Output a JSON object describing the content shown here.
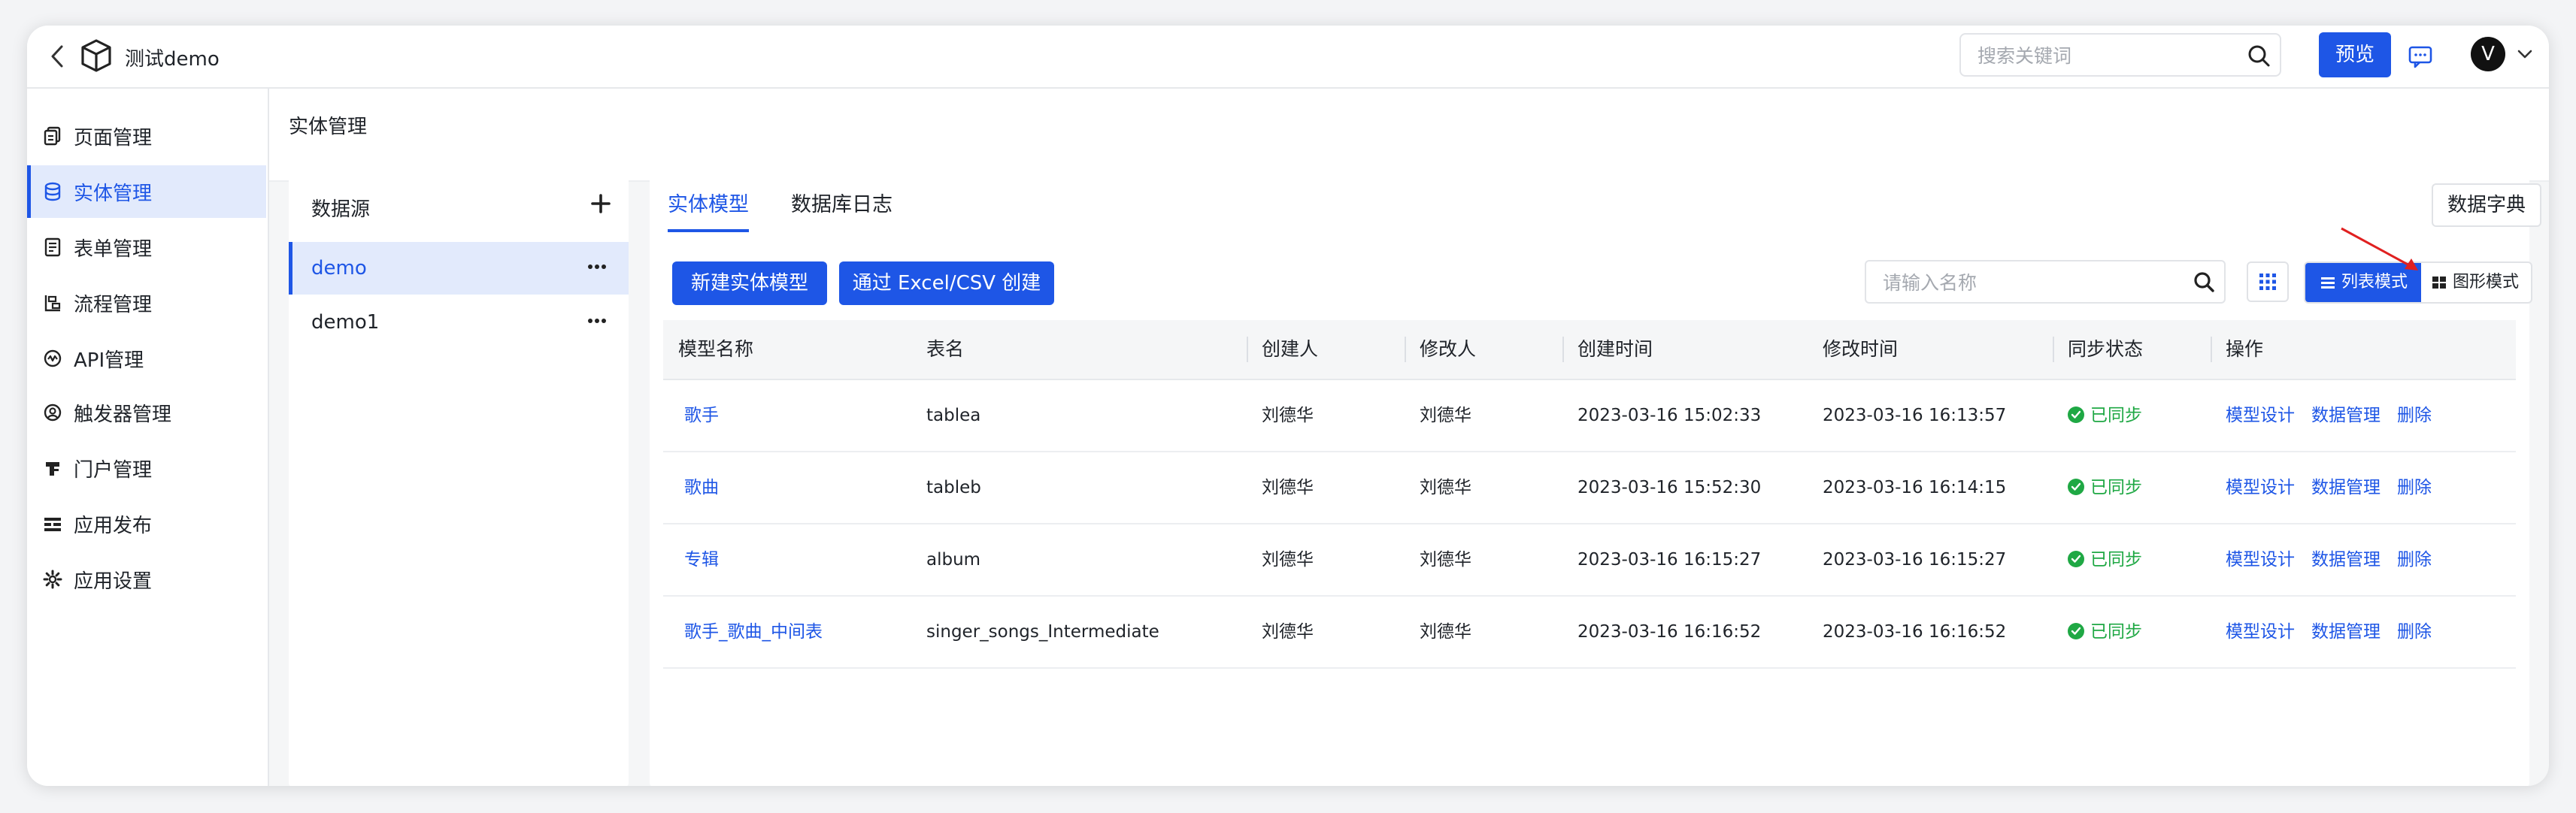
{
  "header": {
    "app_title": "测试demo",
    "search_placeholder": "搜索关键词",
    "preview_label": "预览",
    "avatar_letter": "V"
  },
  "sidebar": {
    "items": [
      {
        "label": "页面管理",
        "icon": "pages-icon"
      },
      {
        "label": "实体管理",
        "icon": "database-icon",
        "active": true
      },
      {
        "label": "表单管理",
        "icon": "form-icon"
      },
      {
        "label": "流程管理",
        "icon": "flow-icon"
      },
      {
        "label": "API管理",
        "icon": "api-icon"
      },
      {
        "label": "触发器管理",
        "icon": "trigger-icon"
      },
      {
        "label": "门户管理",
        "icon": "portal-icon"
      },
      {
        "label": "应用发布",
        "icon": "publish-icon"
      },
      {
        "label": "应用设置",
        "icon": "gear-icon"
      }
    ]
  },
  "breadcrumb": "实体管理",
  "datasource": {
    "title": "数据源",
    "items": [
      {
        "label": "demo",
        "active": true
      },
      {
        "label": "demo1"
      }
    ]
  },
  "tabs": [
    "实体模型",
    "数据库日志"
  ],
  "toolbar": {
    "dict_label": "数据字典",
    "new_model_label": "新建实体模型",
    "import_label": "通过 Excel/CSV 创建",
    "search_placeholder": "请输入名称",
    "list_mode_label": "列表模式",
    "graph_mode_label": "图形模式"
  },
  "table": {
    "columns": [
      "模型名称",
      "表名",
      "创建人",
      "修改人",
      "创建时间",
      "修改时间",
      "同步状态",
      "操作"
    ],
    "rows": [
      {
        "name": "歌手",
        "table": "tablea",
        "creator": "刘德华",
        "modifier": "刘德华",
        "created": "2023-03-16 15:02:33",
        "modified": "2023-03-16 16:13:57",
        "status": "已同步"
      },
      {
        "name": "歌曲",
        "table": "tableb",
        "creator": "刘德华",
        "modifier": "刘德华",
        "created": "2023-03-16 15:52:30",
        "modified": "2023-03-16 16:14:15",
        "status": "已同步"
      },
      {
        "name": "专辑",
        "table": "album",
        "creator": "刘德华",
        "modifier": "刘德华",
        "created": "2023-03-16 16:15:27",
        "modified": "2023-03-16 16:15:27",
        "status": "已同步"
      },
      {
        "name": "歌手_歌曲_中间表",
        "table": "singer_songs_Intermediate",
        "creator": "刘德华",
        "modifier": "刘德华",
        "created": "2023-03-16 16:16:52",
        "modified": "2023-03-16 16:16:52",
        "status": "已同步"
      }
    ],
    "actions": [
      "模型设计",
      "数据管理",
      "删除"
    ]
  },
  "colors": {
    "accent": "#1e56e6",
    "success": "#1fa844",
    "annotation_arrow": "#e02020"
  }
}
